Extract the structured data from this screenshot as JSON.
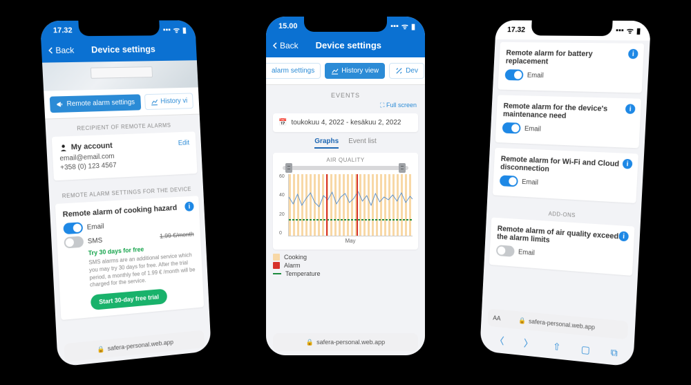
{
  "phone1": {
    "time": "17.32",
    "back": "Back",
    "title": "Device settings",
    "tabs": {
      "alarm": "Remote alarm settings",
      "history": "History vi"
    },
    "recipient_head": "RECIPIENT OF REMOTE ALARMS",
    "account": {
      "label": "My account",
      "edit": "Edit",
      "email": "email@email.com",
      "phone": "+358 (0) 123 4567"
    },
    "device_head": "REMOTE ALARM SETTINGS FOR THE DEVICE",
    "hazard": {
      "title": "Remote alarm of cooking hazard",
      "email": "Email",
      "sms": "SMS",
      "price": "1.99 €/month",
      "try": "Try 30 days for free",
      "desc": "SMS alarms are an additional service which you may try 30 days for free. After the trial period, a monthly fee of 1.99 € /month will be charged for the service.",
      "cta": "Start 30-day free trial"
    },
    "url": "safera-personal.web.app"
  },
  "phone2": {
    "time": "15.00",
    "back": "Back",
    "title": "Device settings",
    "tabs": {
      "alarm": "alarm settings",
      "history": "History view",
      "dev": "Dev"
    },
    "events": "EVENTS",
    "fullscreen": "Full screen",
    "date_range": "toukokuu 4, 2022 - kesäkuu 2, 2022",
    "subtabs": {
      "graphs": "Graphs",
      "eventlist": "Event list"
    },
    "chart_title": "AIR QUALITY",
    "x_label": "May",
    "legend": {
      "cooking": "Cooking",
      "alarm": "Alarm",
      "temp": "Temperature"
    },
    "url": "safera-personal.web.app"
  },
  "phone3": {
    "time": "17.32",
    "alarms": [
      {
        "title": "Remote alarm for battery replacement",
        "label": "Email",
        "on": true
      },
      {
        "title": "Remote alarm for the device's maintenance need",
        "label": "Email",
        "on": true
      },
      {
        "title": "Remote alarm for Wi-Fi and Cloud disconnection",
        "label": "Email",
        "on": true
      }
    ],
    "addons_head": "ADD-ONS",
    "addon": {
      "title": "Remote alarm of air quality exceeds the alarm limits",
      "label": "Email",
      "on": false
    },
    "aa": "AA",
    "url": "safera-personal.web.app"
  },
  "chart_data": {
    "type": "line",
    "title": "AIR QUALITY",
    "xlabel": "May",
    "ylabel": "",
    "ylim": [
      0,
      60
    ],
    "y_ticks": [
      0,
      20,
      40,
      60
    ],
    "series": [
      {
        "name": "Air quality index",
        "color": "#5b8fc7",
        "values": [
          45,
          34,
          48,
          30,
          42,
          50,
          38,
          33,
          46,
          40,
          52,
          36,
          44,
          49,
          37,
          41,
          53,
          39,
          47,
          35,
          50,
          38,
          45,
          42,
          48,
          40,
          51,
          37,
          46,
          43
        ]
      },
      {
        "name": "Temperature",
        "color": "#1b8a3c",
        "values": [
          22,
          22,
          23,
          22,
          22,
          23,
          22,
          21,
          22,
          22,
          23,
          22,
          22,
          23,
          22,
          22,
          23,
          22,
          22,
          22,
          23,
          22,
          22,
          23,
          22,
          22,
          23,
          22,
          22,
          22
        ]
      }
    ],
    "overlays": [
      {
        "name": "Cooking",
        "color": "#f8d8a6",
        "style": "bars"
      },
      {
        "name": "Alarm",
        "color": "#d6322b",
        "style": "bars"
      }
    ]
  }
}
